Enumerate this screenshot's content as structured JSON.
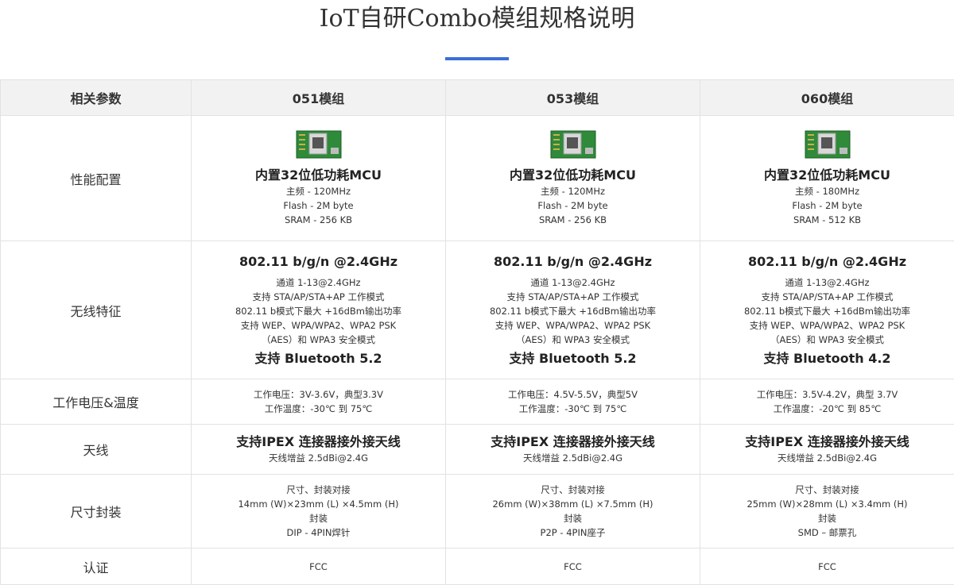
{
  "page": {
    "title": "IoT自研Combo模组规格说明",
    "accent": "#3b6fd9"
  },
  "table": {
    "headers": [
      "相关参数",
      "051模组",
      "053模组",
      "060模组"
    ],
    "rows": {
      "perf": {
        "label": "性能配置",
        "cells": [
          {
            "head": "内置32位低功耗MCU",
            "lines": [
              "主频 - 120MHz",
              "Flash - 2M byte",
              "SRAM - 256 KB"
            ]
          },
          {
            "head": "内置32位低功耗MCU",
            "lines": [
              "主频 - 120MHz",
              "Flash - 2M byte",
              "SRAM - 256 KB"
            ]
          },
          {
            "head": "内置32位低功耗MCU",
            "lines": [
              "主频 - 180MHz",
              "Flash - 2M byte",
              "SRAM - 512 KB"
            ]
          }
        ]
      },
      "wireless": {
        "label": "无线特征",
        "cells": [
          {
            "head": "802.11 b/g/n @2.4GHz",
            "lines": [
              "通道 1-13@2.4GHz",
              "支持 STA/AP/STA+AP 工作模式",
              "802.11 b模式下最大 +16dBm输出功率",
              "支持 WEP、WPA/WPA2、WPA2 PSK",
              "（AES）和 WPA3 安全模式"
            ],
            "foot": "支持 Bluetooth 5.2"
          },
          {
            "head": "802.11 b/g/n @2.4GHz",
            "lines": [
              "通道 1-13@2.4GHz",
              "支持 STA/AP/STA+AP 工作模式",
              "802.11 b模式下最大 +16dBm输出功率",
              "支持 WEP、WPA/WPA2、WPA2 PSK",
              "（AES）和 WPA3 安全模式"
            ],
            "foot": "支持 Bluetooth 5.2"
          },
          {
            "head": "802.11 b/g/n @2.4GHz",
            "lines": [
              "通道 1-13@2.4GHz",
              "支持 STA/AP/STA+AP 工作模式",
              "802.11 b模式下最大 +16dBm输出功率",
              "支持 WEP、WPA/WPA2、WPA2 PSK",
              "（AES）和 WPA3 安全模式"
            ],
            "foot": "支持 Bluetooth 4.2"
          }
        ]
      },
      "power": {
        "label": "工作电压&温度",
        "cells": [
          {
            "lines": [
              "工作电压：3V-3.6V，典型3.3V",
              "工作温度：-30℃ 到 75℃"
            ]
          },
          {
            "lines": [
              "工作电压：4.5V-5.5V，典型5V",
              "工作温度：-30℃ 到 75℃"
            ]
          },
          {
            "lines": [
              "工作电压：3.5V-4.2V，典型 3.7V",
              "工作温度：-20℃ 到 85℃"
            ]
          }
        ]
      },
      "antenna": {
        "label": "天线",
        "cells": [
          {
            "head": "支持IPEX 连接器接外接天线",
            "lines": [
              "天线增益 2.5dBi@2.4G"
            ]
          },
          {
            "head": "支持IPEX 连接器接外接天线",
            "lines": [
              "天线增益 2.5dBi@2.4G"
            ]
          },
          {
            "head": "支持IPEX 连接器接外接天线",
            "lines": [
              "天线增益 2.5dBi@2.4G"
            ]
          }
        ]
      },
      "package": {
        "label": "尺寸封装",
        "cells": [
          {
            "lines": [
              "尺寸、封装对接",
              "14mm (W)×23mm (L) ×4.5mm (H)",
              "封装",
              "DIP - 4PIN焊针"
            ]
          },
          {
            "lines": [
              "尺寸、封装对接",
              "26mm (W)×38mm (L) ×7.5mm (H)",
              "封装",
              "P2P - 4PIN座子"
            ]
          },
          {
            "lines": [
              "尺寸、封装对接",
              "25mm (W)×28mm (L) ×3.4mm (H)",
              "封装",
              "SMD – 邮票孔"
            ]
          }
        ]
      },
      "cert": {
        "label": "认证",
        "cells": [
          {
            "lines": [
              "FCC"
            ]
          },
          {
            "lines": [
              "FCC"
            ]
          },
          {
            "lines": [
              "FCC"
            ]
          }
        ]
      }
    }
  }
}
